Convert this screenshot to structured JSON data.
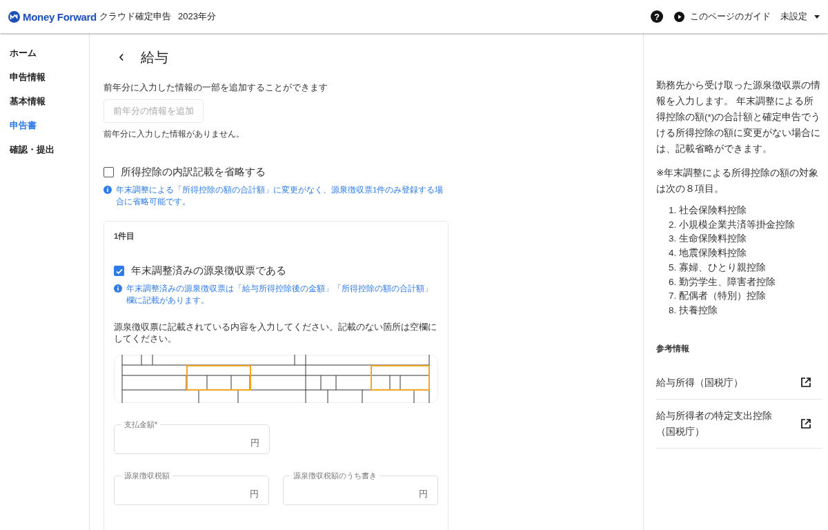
{
  "header": {
    "brand": "Money Forward",
    "product": "クラウド確定申告",
    "year": "2023年分",
    "help_mark": "?",
    "guide": "このページのガイド",
    "user": "未設定"
  },
  "sidebar": {
    "items": [
      {
        "label": "ホーム",
        "selected": false
      },
      {
        "label": "申告情報",
        "selected": false
      },
      {
        "label": "基本情報",
        "selected": false
      },
      {
        "label": "申告書",
        "selected": true
      },
      {
        "label": "確認・提出",
        "selected": false
      }
    ]
  },
  "page": {
    "title": "給与",
    "import_note": "前年分に入力した情報の一部を追加することができます",
    "import_button": {
      "label": "前年分の情報を追加",
      "disabled": true
    },
    "import_status": "前年分に入力した情報がありません。",
    "omit_checkbox": {
      "label": "所得控除の内訳記載を省略する",
      "checked": false
    },
    "omit_hint": "年末調整による「所得控除の額の合計額」に変更がなく、源泉徴収票1件のみ登録する場合に省略可能です。",
    "slip": {
      "heading": "1件目",
      "adjusted_checkbox": {
        "label": "年末調整済みの源泉徴収票である",
        "checked": true
      },
      "adjusted_hint": "年末調整済みの源泉徴収票は「給与所得控除後の金額」「所得控除の額の合計額」欄に記載があります。",
      "instruction": "源泉徴収票に記載されている内容を入力してください。記載のない箇所は空欄にしてください。",
      "fields": [
        {
          "label": "支払金額*",
          "unit": "円"
        },
        {
          "label": "源泉徴収税額",
          "unit": "円"
        },
        {
          "label": "源泉徴収税額のうち書き",
          "unit": "円"
        }
      ]
    }
  },
  "help": {
    "intro": "勤務先から受け取った源泉徴収票の情報を入力します。 年末調整による所得控除の額(*)の合計額と確定申告でうける所得控除の額に変更がない場合には、記載省略ができます。",
    "note": "※年末調整による所得控除の額の対象は次の８項目。",
    "items": [
      {
        "number": "1.",
        "label": "社会保険料控除"
      },
      {
        "number": "2.",
        "label": "小規模企業共済等掛金控除"
      },
      {
        "number": "3.",
        "label": "生命保険料控除"
      },
      {
        "number": "4.",
        "label": "地震保険料控除"
      },
      {
        "number": "5.",
        "label": "寡婦、ひとり親控除"
      },
      {
        "number": "6.",
        "label": "勤労学生、障害者控除"
      },
      {
        "number": "7.",
        "label": "配偶者（特別）控除"
      },
      {
        "number": "8.",
        "label": "扶養控除"
      }
    ],
    "reference_heading": "参考情報",
    "links": [
      {
        "label": "給与所得（国税庁）"
      },
      {
        "label": "給与所得者の特定支出控除（国税庁）"
      }
    ]
  }
}
